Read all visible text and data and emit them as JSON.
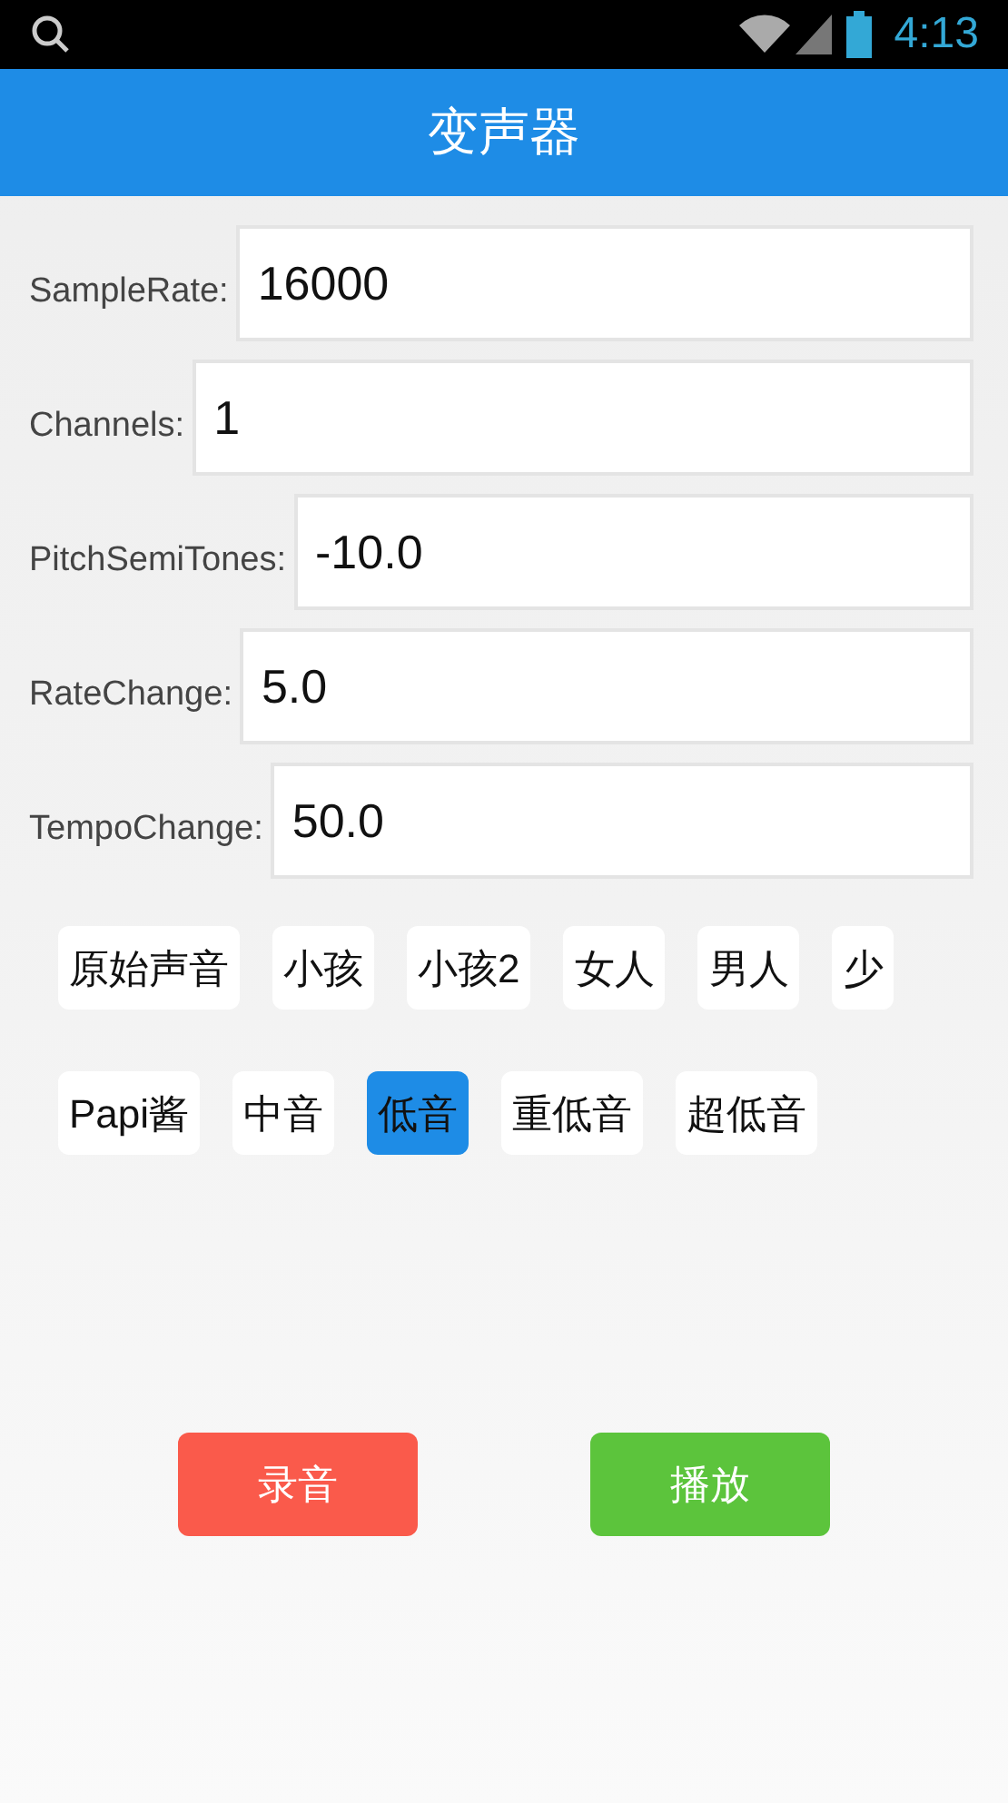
{
  "status_bar": {
    "time": "4:13"
  },
  "title": "变声器",
  "fields": [
    {
      "label": "SampleRate:",
      "value": "16000"
    },
    {
      "label": "Channels:",
      "value": "1"
    },
    {
      "label": "PitchSemiTones:",
      "value": "-10.0"
    },
    {
      "label": "RateChange:",
      "value": "5.0"
    },
    {
      "label": "TempoChange:",
      "value": "50.0"
    }
  ],
  "presets_row_1": [
    {
      "label": "原始声音",
      "selected": false
    },
    {
      "label": "小孩",
      "selected": false
    },
    {
      "label": "小孩2",
      "selected": false
    },
    {
      "label": "女人",
      "selected": false
    },
    {
      "label": "男人",
      "selected": false
    },
    {
      "label": "少",
      "selected": false
    }
  ],
  "presets_row_2": [
    {
      "label": "Papi酱",
      "selected": false
    },
    {
      "label": "中音",
      "selected": false
    },
    {
      "label": "低音",
      "selected": true
    },
    {
      "label": "重低音",
      "selected": false
    },
    {
      "label": "超低音",
      "selected": false
    }
  ],
  "actions": [
    {
      "label": "录音",
      "color": "#fa5a4b"
    },
    {
      "label": "播放",
      "color": "#5cc43c"
    }
  ]
}
